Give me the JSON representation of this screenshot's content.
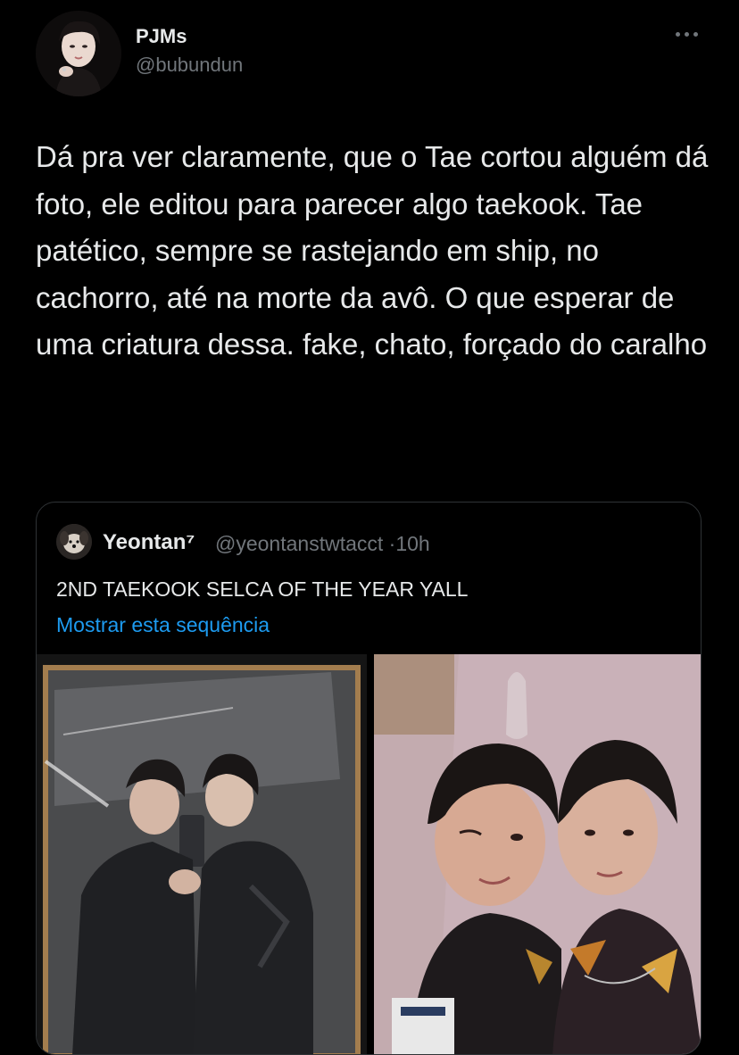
{
  "tweet": {
    "author": {
      "display_name": "PJMs",
      "handle": "@bubundun",
      "avatar_icon": "profile-photo"
    },
    "text": "Dá pra ver claramente, que o Tae cortou alguém dá foto, ele editou para parecer algo taekook. Tae patético, sempre se rastejando em ship, no cachorro, até na morte da avô. O que esperar de uma criatura dessa. fake, chato, forçado do caralho",
    "more_icon": "ellipsis-icon"
  },
  "quoted_tweet": {
    "author": {
      "display_name": "Yeontan⁷",
      "handle": "@yeontanstwtacct",
      "time": "10h",
      "separator": "·"
    },
    "text": "2ND TAEKOOK SELCA OF THE YEAR YALL",
    "show_thread": "Mostrar esta sequência",
    "media": [
      {
        "kind": "photo",
        "icon": "mirror-selfie-photo"
      },
      {
        "kind": "photo",
        "icon": "selfie-photo"
      }
    ]
  },
  "colors": {
    "background": "#000000",
    "text": "#e7e9ea",
    "secondary": "#71767b",
    "link": "#1d9bf0",
    "border": "#2f3336"
  }
}
